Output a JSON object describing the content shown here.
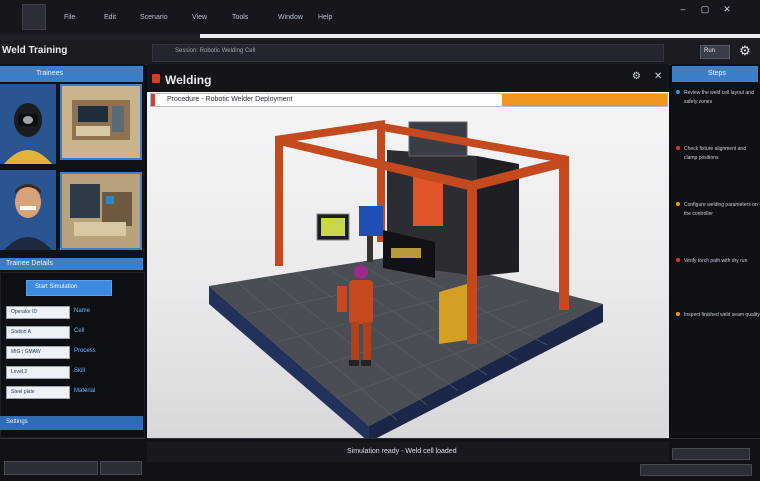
{
  "menu": {
    "items": [
      "File",
      "Edit",
      "Scenario",
      "View",
      "Tools",
      "Window",
      "Help"
    ],
    "window_controls": [
      "–",
      "▢",
      "✕"
    ]
  },
  "app": {
    "title": "Weld Training",
    "header_tab": "Session: Robotic Welding Cell",
    "header_button": "Run",
    "tool_icon": "robot-arm-icon"
  },
  "left_panel": {
    "title": "Trainees",
    "section_label": "Trainee Details",
    "primary_button": "Start Simulation",
    "fields": [
      {
        "value": "Operator ID",
        "label": "Name"
      },
      {
        "value": "Station A",
        "label": "Cell"
      },
      {
        "value": "MIG / GMAW",
        "label": "Process"
      },
      {
        "value": "Level 2",
        "label": "Skill"
      },
      {
        "value": "Steel plate",
        "label": "Material"
      }
    ],
    "footer_label": "Settings"
  },
  "viewport": {
    "title": "Welding",
    "progress_label": "Procedure - Robotic Welder Deployment",
    "progress_percent": 68,
    "status_text": "Simulation ready - Weld cell loaded"
  },
  "right_panel": {
    "title": "Steps",
    "items": [
      {
        "text": "Review the weld cell layout and safety zones",
        "color": "#3c8de0"
      },
      {
        "text": "Check fixture alignment and clamp positions",
        "color": "#d93a2b"
      },
      {
        "text": "Configure welding parameters on the controller",
        "color": "#f0961e"
      },
      {
        "text": "Verify torch path with dry run",
        "color": "#d93a2b"
      },
      {
        "text": "Inspect finished weld seam quality",
        "color": "#f0961e"
      }
    ]
  },
  "colors": {
    "accent": "#3c7fc9",
    "progress": "#f0961e",
    "alert": "#d93a2b"
  }
}
